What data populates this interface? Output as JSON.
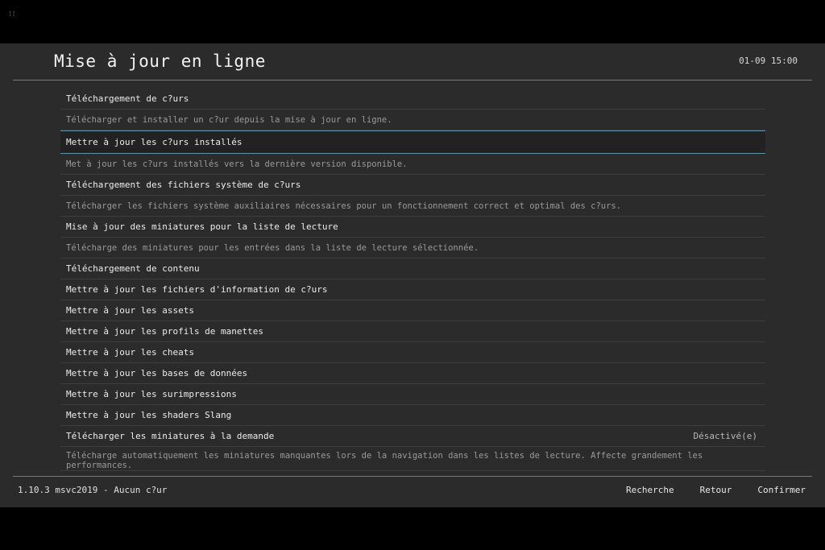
{
  "header": {
    "title": "Mise à jour en ligne",
    "clock": "01-09 15:00"
  },
  "menu": [
    {
      "kind": "label",
      "text": "Téléchargement de c?urs"
    },
    {
      "kind": "desc",
      "text": "Télécharger et installer un c?ur depuis la mise à jour en ligne."
    },
    {
      "kind": "label",
      "text": "Mettre à jour les c?urs installés",
      "selected": true
    },
    {
      "kind": "desc",
      "text": "Met à jour les c?urs installés vers la dernière version disponible."
    },
    {
      "kind": "label",
      "text": "Téléchargement des fichiers système de c?urs"
    },
    {
      "kind": "desc",
      "text": "Télécharger les fichiers système auxiliaires nécessaires pour un fonctionnement correct et optimal des c?urs."
    },
    {
      "kind": "label",
      "text": "Mise à jour des miniatures pour la liste de lecture"
    },
    {
      "kind": "desc",
      "text": "Télécharge des miniatures pour les entrées dans la liste de lecture sélectionnée."
    },
    {
      "kind": "label",
      "text": "Téléchargement de contenu"
    },
    {
      "kind": "label",
      "text": "Mettre à jour les fichiers d'information de c?urs"
    },
    {
      "kind": "label",
      "text": "Mettre à jour les assets"
    },
    {
      "kind": "label",
      "text": "Mettre à jour les profils de manettes"
    },
    {
      "kind": "label",
      "text": "Mettre à jour les cheats"
    },
    {
      "kind": "label",
      "text": "Mettre à jour les bases de données"
    },
    {
      "kind": "label",
      "text": "Mettre à jour les surimpressions"
    },
    {
      "kind": "label",
      "text": "Mettre à jour les shaders Slang"
    },
    {
      "kind": "label",
      "text": "Télécharger les miniatures à la demande",
      "value": "Désactivé(e)"
    },
    {
      "kind": "desc",
      "text": "Télécharge automatiquement les miniatures manquantes lors de la navigation dans les listes de lecture. Affecte grandement les performances.",
      "tall": true
    }
  ],
  "footer": {
    "version": "1.10.3 msvc2019 - Aucun c?ur",
    "search_label": "Recherche",
    "back_label": "Retour",
    "confirm_label": "Confirmer"
  }
}
